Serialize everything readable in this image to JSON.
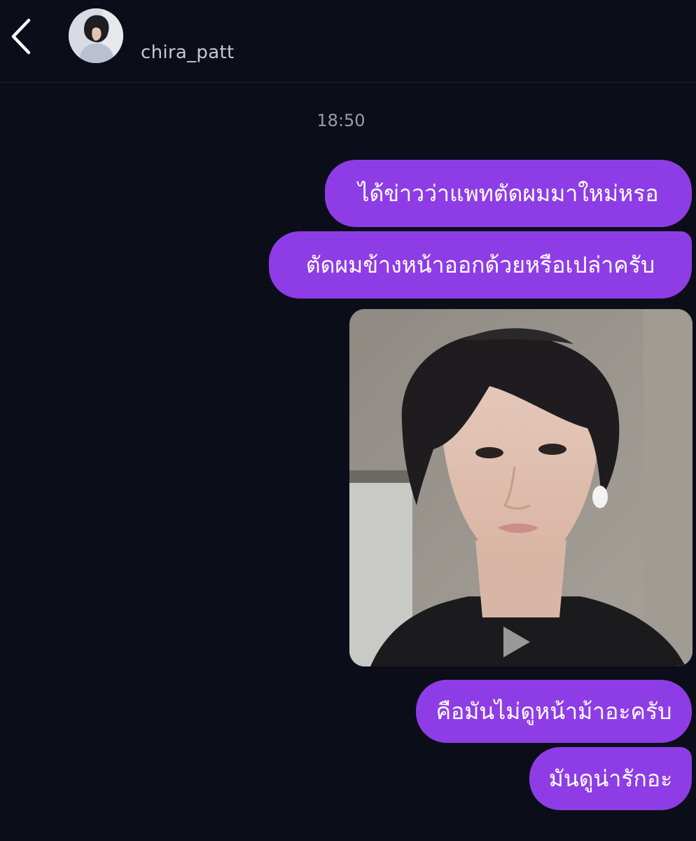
{
  "header": {
    "username": "chira_patt",
    "back_icon": "chevron-left-icon",
    "avatar": "profile-avatar"
  },
  "conversation": {
    "timestamp": "18:50",
    "messages": [
      {
        "text": "ได้ข่าวว่าแพทตัดผมมาใหม่หรอ"
      },
      {
        "text": "ตัดผมข้างหน้าออกด้วยหรือเปล่าครับ"
      },
      {
        "media": "video",
        "icon": "play-icon"
      },
      {
        "text": "คือมันไม่ดูหน้าม้าอะครับ"
      },
      {
        "text": "มันดูน่ารักอะ"
      }
    ]
  },
  "colors": {
    "background": "#0b0e18",
    "bubble": "#8e3de6",
    "text": "#ffffff",
    "muted": "#9a9ca6"
  }
}
